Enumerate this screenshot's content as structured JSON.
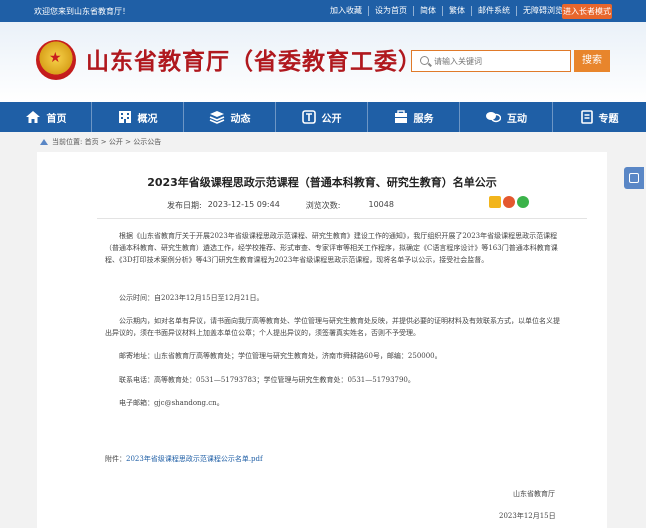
{
  "topbar": {
    "welcome": "欢迎您来到山东省教育厅！",
    "links": [
      "加入收藏",
      "设为首页",
      "简体",
      "繁体",
      "邮件系统",
      "无障碍浏览"
    ],
    "elder_mode": "进入长者模式"
  },
  "header": {
    "site_title": "山东省教育厅（省委教育工委）",
    "search_placeholder": "请输入关键词",
    "search_button": "搜索"
  },
  "nav": [
    {
      "label": "首页",
      "icon": "home-icon"
    },
    {
      "label": "概况",
      "icon": "building-icon"
    },
    {
      "label": "动态",
      "icon": "stack-icon"
    },
    {
      "label": "公开",
      "icon": "open-icon"
    },
    {
      "label": "服务",
      "icon": "service-icon"
    },
    {
      "label": "互动",
      "icon": "chat-icon"
    },
    {
      "label": "专题",
      "icon": "document-icon"
    }
  ],
  "breadcrumb": "当前位置: 首页 > 公开 > 公示公告",
  "article": {
    "title": "2023年省级课程思政示范课程（普通本科教育、研究生教育）名单公示",
    "publish_label": "发布日期:",
    "publish_date": "2023-12-15 09:44",
    "views_label": "浏览次数:",
    "views": "10048",
    "para1": "根据《山东省教育厅关于开展2023年省级课程思政示范课程、研究生教育》建设工作的通知》，我厅组织开展了2023年省级课程思政示范课程（普通本科教育、研究生教育）遴选工作，经学校推荐、形式审查、专家评审等相关工作程序，拟确定《C语言程序设计》等163门普通本科教育课程、《3D打印技术案例分析》等43门研究生教育课程为2023年省级课程思政示范课程，现将名单予以公示，接受社会监督。",
    "para2": "公示时间：自2023年12月15日至12月21日。",
    "para3": "公示期内，如对名单有异议，请书面向我厅高等教育处、学位管理与研究生教育处反映，并提供必要的证明材料及有效联系方式，以单位名义提出异议的，须在书面异议材料上加盖本单位公章；个人提出异议的，须签署真实姓名，否则不予受理。",
    "para4": "邮寄地址：山东省教育厅高等教育处；学位管理与研究生教育处，济南市舜耕路60号，邮编：250000。",
    "para5": "联系电话：高等教育处：0531—51793783；学位管理与研究生教育处：0531—51793790。",
    "para6": "电子邮箱：gjc@shandong.cn。",
    "attachment_label": "附件：",
    "attachment_link": "2023年省级课程思政示范课程公示名单.pdf",
    "signature_org": "山东省教育厅",
    "signature_date": "2023年12月15日"
  }
}
